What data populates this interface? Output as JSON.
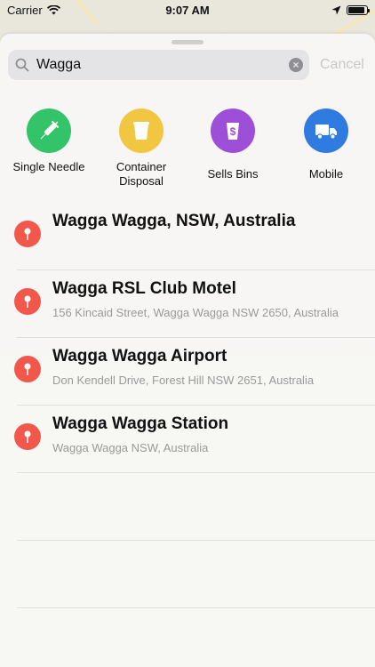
{
  "status": {
    "carrier": "Carrier",
    "time": "9:07 AM",
    "battery_level": 0.9
  },
  "search": {
    "value": "Wagga",
    "placeholder": "Search",
    "cancel_label": "Cancel"
  },
  "categories": [
    {
      "label": "Single Needle",
      "color": "#33c469",
      "icon": "syringe-icon"
    },
    {
      "label": "Container Disposal",
      "color": "#f1c741",
      "icon": "container-icon"
    },
    {
      "label": "Sells Bins",
      "color": "#9d4fd8",
      "icon": "dollar-bin-icon"
    },
    {
      "label": "Mobile",
      "color": "#2f7bdf",
      "icon": "truck-icon"
    }
  ],
  "results": [
    {
      "title": "Wagga Wagga, NSW, Australia",
      "subtitle": ""
    },
    {
      "title": "Wagga RSL Club Motel",
      "subtitle": "156 Kincaid Street, Wagga Wagga NSW 2650, Australia"
    },
    {
      "title": "Wagga Wagga Airport",
      "subtitle": "Don Kendell Drive, Forest Hill NSW 2651, Australia"
    },
    {
      "title": "Wagga Wagga Station",
      "subtitle": "Wagga Wagga NSW, Australia"
    }
  ],
  "colors": {
    "pin": "#f2574b",
    "cancel_disabled": "#c8c8cc"
  }
}
